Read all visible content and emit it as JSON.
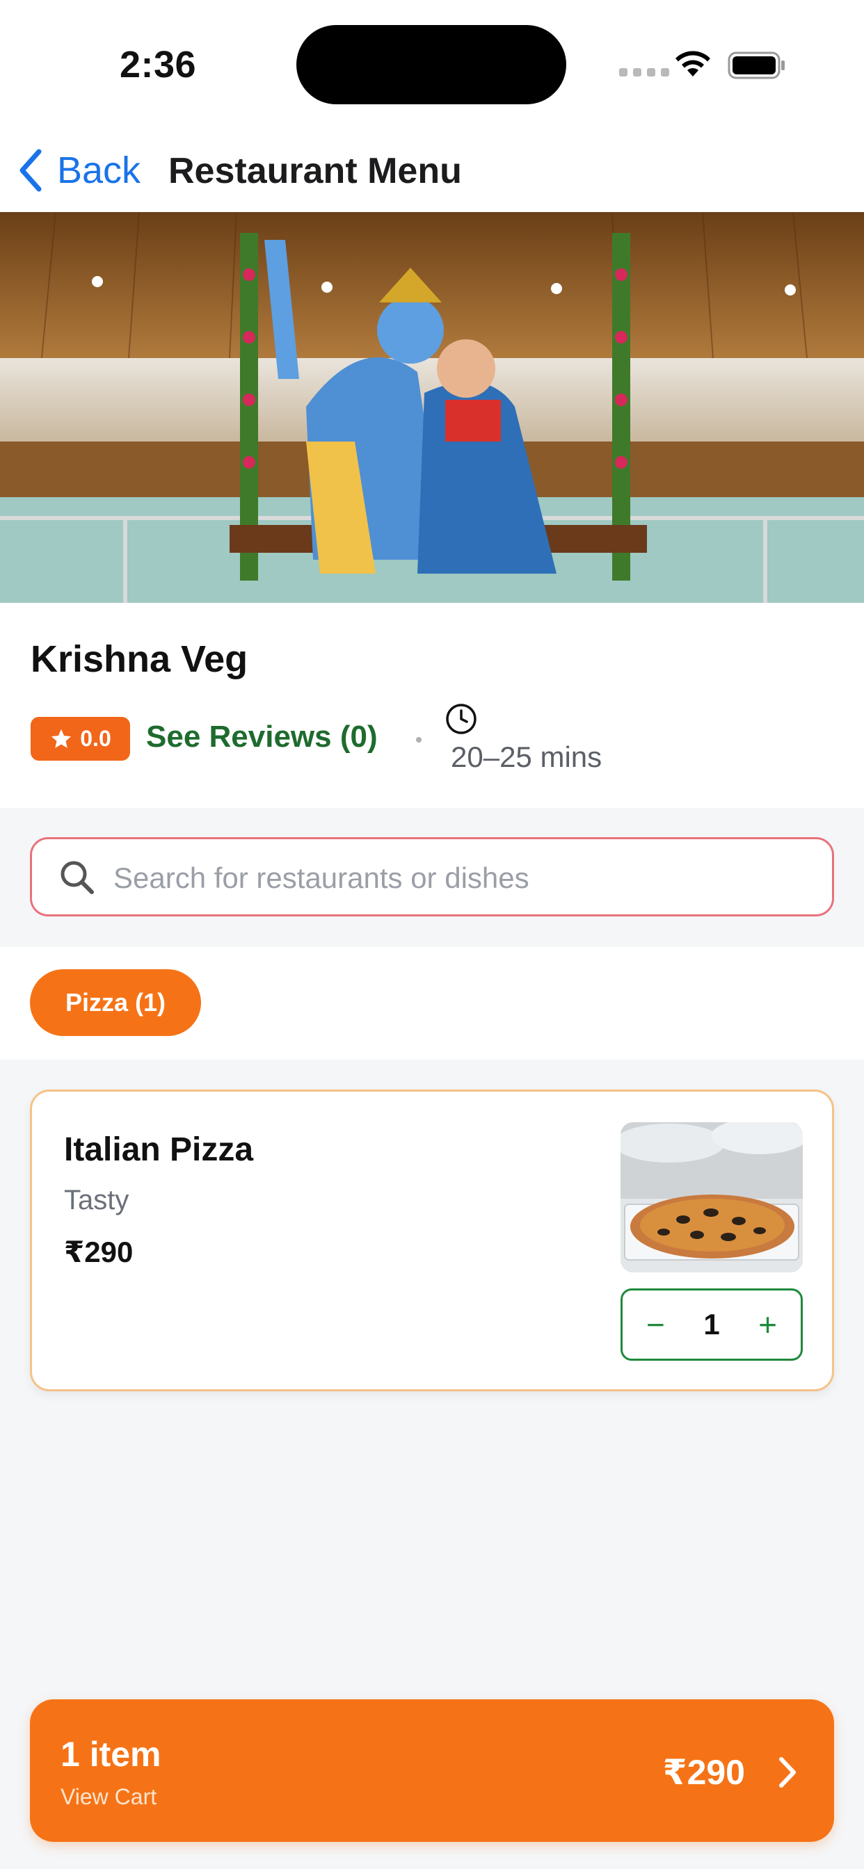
{
  "status_bar": {
    "time": "2:36"
  },
  "nav": {
    "back_label": "Back",
    "title": "Restaurant Menu"
  },
  "restaurant": {
    "name": "Krishna Veg",
    "rating": "0.0",
    "reviews_label": "See Reviews (0)",
    "delivery_time": "20–25 mins"
  },
  "search": {
    "placeholder": "Search for restaurants or dishes",
    "value": ""
  },
  "categories": [
    {
      "label": "Pizza (1)",
      "selected": true
    }
  ],
  "menu_items": [
    {
      "name": "Italian Pizza",
      "description": "Tasty",
      "price": "₹290",
      "quantity": "1",
      "decrement_symbol": "−",
      "increment_symbol": "+"
    }
  ],
  "cart": {
    "count_label": "1 item",
    "action_label": "View Cart",
    "total": "₹290"
  },
  "colors": {
    "accent_orange": "#f57316",
    "link_blue": "#1a73e8",
    "green": "#1f8a3c",
    "search_border": "#e7727a"
  },
  "icons": {
    "back": "chevron-left-icon",
    "rating": "star-icon",
    "time": "clock-icon",
    "search": "search-icon",
    "cart": "chevron-right-icon"
  }
}
